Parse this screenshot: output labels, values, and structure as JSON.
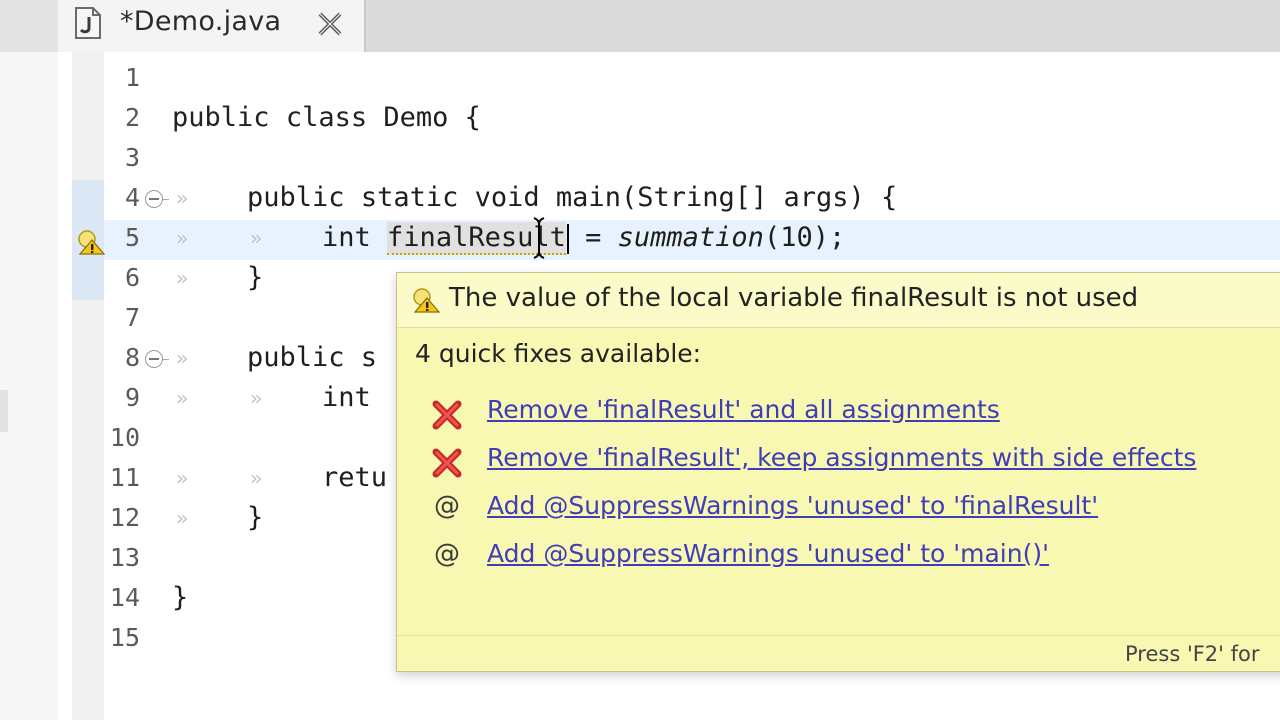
{
  "tab": {
    "title": "*Demo.java",
    "icon": "java-file-icon"
  },
  "editor": {
    "line_numbers": [
      "1",
      "2",
      "3",
      "4",
      "5",
      "6",
      "7",
      "8",
      "9",
      "10",
      "11",
      "12",
      "13",
      "14",
      "15"
    ],
    "code": {
      "l2": {
        "kw1": "public",
        "kw2": "class",
        "name": "Demo",
        "brace": "{"
      },
      "l4": {
        "kw1": "public",
        "kw2": "static",
        "kw3": "void",
        "sig": "main(String[] args) {"
      },
      "l5": {
        "type": "int",
        "var": "finalResult",
        "eq": " = ",
        "call": "summation",
        "args": "(10);"
      },
      "l6": "}",
      "l8": "public s",
      "l9": "int",
      "l11": "retu",
      "l12": "}",
      "l14": "}"
    }
  },
  "quickfix": {
    "title": "The value of the local variable finalResult is not used",
    "subtitle": "4 quick fixes available:",
    "fixes": [
      {
        "label": "Remove 'finalResult' and all assignments",
        "icon": "remove-icon"
      },
      {
        "label": "Remove 'finalResult', keep assignments with side effects",
        "icon": "remove-icon"
      },
      {
        "label": "Add @SuppressWarnings 'unused' to 'finalResult'",
        "icon": "annotation-icon"
      },
      {
        "label": "Add @SuppressWarnings 'unused' to 'main()'",
        "icon": "annotation-icon"
      }
    ],
    "annotation_glyph": "@",
    "footer": "Press 'F2' for"
  },
  "colors": {
    "popup_bg": "#f9f8b3",
    "link": "#3e3eb8",
    "line_highlight": "#e8f2fe"
  }
}
